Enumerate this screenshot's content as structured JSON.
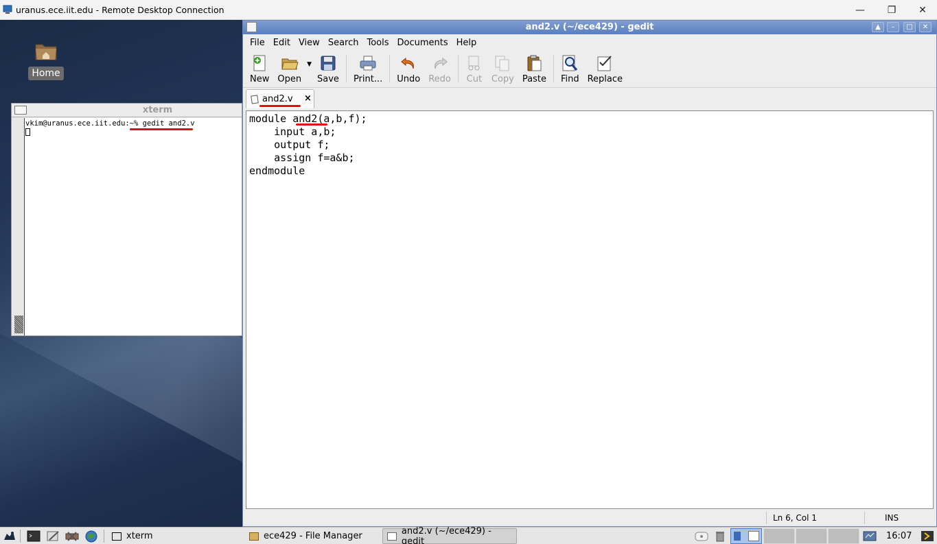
{
  "rdp": {
    "title": "uranus.ece.iit.edu - Remote Desktop Connection",
    "minimize": "—",
    "restore": "❐",
    "close": "✕"
  },
  "desktop": {
    "home_label": "Home"
  },
  "xterm": {
    "title": "xterm",
    "prompt": "vkim@uranus.ece.iit.edu:~% gedit and2.v"
  },
  "gedit": {
    "title": "and2.v (~/ece429) - gedit",
    "menu": [
      "File",
      "Edit",
      "View",
      "Search",
      "Tools",
      "Documents",
      "Help"
    ],
    "toolbar": {
      "new": "New",
      "open": "Open",
      "save": "Save",
      "print": "Print...",
      "undo": "Undo",
      "redo": "Redo",
      "cut": "Cut",
      "copy": "Copy",
      "paste": "Paste",
      "find": "Find",
      "replace": "Replace"
    },
    "tab": {
      "name": "and2.v",
      "close": "×"
    },
    "code": [
      "module and2(a,b,f);",
      "    input a,b;",
      "    output f;",
      "    assign f=a&b;",
      "endmodule"
    ],
    "status": {
      "position": "Ln 6, Col 1",
      "mode": "INS"
    }
  },
  "panel": {
    "tasks": [
      "xterm",
      "ece429 - File Manager",
      "and2.v (~/ece429) - gedit"
    ],
    "clock": "16:07"
  },
  "colors": {
    "gedit_titlebar": "#6a8ac6",
    "annotation_red": "#e01010",
    "desktop": "#1b2a44"
  }
}
